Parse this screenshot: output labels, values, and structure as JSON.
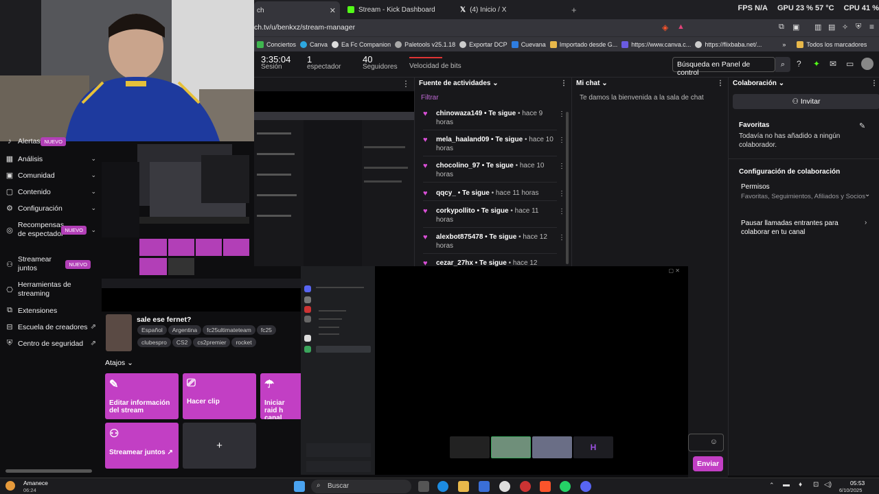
{
  "browser": {
    "tabs": [
      {
        "label": "ch",
        "active": true
      },
      {
        "label": "Stream - Kick Dashboard",
        "active": false
      },
      {
        "label": "(4) Inicio / X",
        "active": false
      }
    ],
    "new_tab": "+",
    "perf": {
      "fps_label": "FPS",
      "fps": "N/A",
      "gpu_label": "GPU",
      "gpu": "23 % 57 °C",
      "cpu_label": "CPU",
      "cpu": "41 %"
    },
    "url": "ch.tv/u/benkxz/stream-manager",
    "bookmarks": [
      "Conciertos",
      "Canva",
      "Ea Fc Companion",
      "Paletools v25.1.18",
      "Exportar DCP",
      "Cuevana",
      "Importado desde G...",
      "https://www.canva.c...",
      "https://flixbaba.net/...",
      "»",
      "Todos los marcadores"
    ]
  },
  "header": {
    "session_value": "3:35:04",
    "session_label": "Sesión",
    "viewers_value": "1",
    "viewers_label": "espectador",
    "followers_value": "40",
    "followers_label": "Seguidores",
    "bitrate_label": "Velocidad de bits",
    "search_placeholder": "Búsqueda en Panel de control"
  },
  "sidebar": {
    "items": [
      {
        "label": "Alertas",
        "badge": "NUEVO"
      },
      {
        "label": "Análisis"
      },
      {
        "label": "Comunidad"
      },
      {
        "label": "Contenido"
      },
      {
        "label": "Configuración"
      },
      {
        "label": "Recompensas de espectador",
        "badge": "NUEVO"
      },
      {
        "label": "Streamear juntos",
        "badge": "NUEVO"
      },
      {
        "label": "Herramientas de streaming"
      },
      {
        "label": "Extensiones"
      },
      {
        "label": "Escuela de creadores"
      },
      {
        "label": "Centro de seguridad"
      }
    ]
  },
  "stream_info": {
    "title": "sale ese fernet?",
    "tags": [
      "Español",
      "Argentina",
      "fc25ultimateteam",
      "fc25",
      "clubespro",
      "CS2",
      "cs2premier",
      "rocket"
    ]
  },
  "shortcuts": {
    "header": "Atajos",
    "tiles": [
      "Editar información del stream",
      "Hacer clip",
      "Iniciar raid h canal",
      "Streamear juntos ↗",
      "+"
    ]
  },
  "activity": {
    "title": "Fuente de actividades",
    "filter": "Filtrar",
    "items": [
      {
        "user": "chinowaza149",
        "action": "• Te sigue",
        "time": "• hace 9 horas"
      },
      {
        "user": "mela_haaland09",
        "action": "• Te sigue",
        "time": "• hace 10 horas"
      },
      {
        "user": "chocolino_97",
        "action": "• Te sigue",
        "time": "• hace 10 horas"
      },
      {
        "user": "qqcy_",
        "action": "• Te sigue",
        "time": "• hace 11 horas"
      },
      {
        "user": "corkypollito",
        "action": "• Te sigue",
        "time": "• hace 11 horas"
      },
      {
        "user": "alexbot875478",
        "action": "• Te sigue",
        "time": "• hace 12 horas"
      },
      {
        "user": "cezar_27hx",
        "action": "• Te sigue",
        "time": "• hace 12"
      }
    ]
  },
  "chat": {
    "title": "Mi chat",
    "welcome": "Te damos la bienvenida a la sala de chat",
    "send": "Enviar"
  },
  "collab": {
    "title": "Colaboración",
    "invite": "Invitar",
    "favorites_title": "Favoritas",
    "favorites_text": "Todavía no has añadido a ningún colaborador.",
    "config_title": "Configuración de colaboración",
    "permissions_title": "Permisos",
    "permissions_text": "Favoritas, Seguimientos, Afiliados y Socios",
    "pause_text": "Pausar llamadas entrantes para colaborar en tu canal"
  },
  "taskbar": {
    "weather_label": "Amanece",
    "weather_time": "06:24",
    "search": "Buscar",
    "clock_time": "05:53",
    "clock_date": "6/10/2025"
  },
  "colors": {
    "accent": "#c23fc4",
    "heart": "#d94fd6",
    "bg": "#0e0e10",
    "panel": "#18181b"
  }
}
